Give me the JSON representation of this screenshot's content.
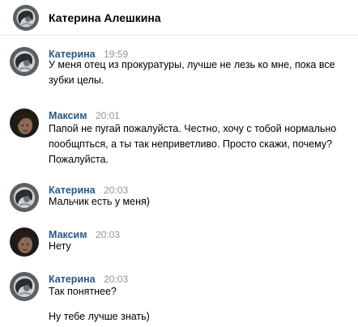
{
  "header": {
    "title": "Катерина Алешкина",
    "avatar_icon": "user-avatar-katerina"
  },
  "messages": [
    {
      "author": "Катерина",
      "time": "19:59",
      "avatar_icon": "user-avatar-katerina",
      "lines": [
        "У меня отец из прокуратуры, лучше не лезь ко мне, пока все",
        "зубки целы."
      ]
    },
    {
      "author": "Максим",
      "time": "20:01",
      "avatar_icon": "user-avatar-maksim",
      "lines": [
        "Папой не пугай пожалуйста. Честно, хочу с тобой нормально",
        "пообщпться, а ты так неприветливо. Просто скажи, почему?",
        "Пожалуйста."
      ]
    },
    {
      "author": "Катерина",
      "time": "20:03",
      "avatar_icon": "user-avatar-katerina",
      "lines": [
        "Мальчик есть у меня)"
      ]
    },
    {
      "author": "Максим",
      "time": "20:03",
      "avatar_icon": "user-avatar-maksim",
      "lines": [
        "Нету"
      ]
    },
    {
      "author": "Катерина",
      "time": "20:03",
      "avatar_icon": "user-avatar-katerina",
      "lines": [
        "Так понятнее?",
        "",
        "Ну тебе лучше знать)"
      ]
    }
  ],
  "colors": {
    "author": "#2a5885",
    "time": "#939393",
    "divider": "#e7e8ec"
  }
}
